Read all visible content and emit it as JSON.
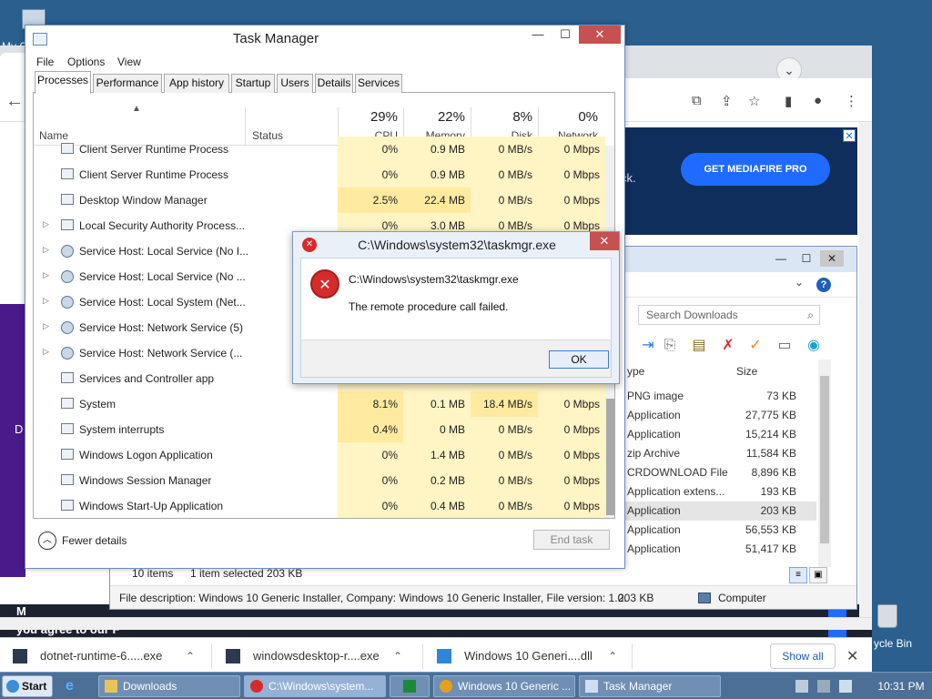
{
  "desktop": {
    "my_computer_label": "My C",
    "recycle_bin_label": "ycle Bin"
  },
  "browser": {
    "ad_text": "ck.",
    "promo_button": "GET MEDIAFIRE PRO",
    "banner_close": "✕",
    "side_letter": "D",
    "agree_text": "you agree to our F",
    "m_text": "M",
    "accent_color": "#1f6bff"
  },
  "downloads": {
    "items": [
      {
        "name": "dotnet-runtime-6.....exe"
      },
      {
        "name": "windowsdesktop-r....exe"
      },
      {
        "name": "Windows 10 Generi....dll"
      }
    ],
    "show_all": "Show all",
    "close": "✕"
  },
  "explorer": {
    "search_placeholder": "Search Downloads",
    "col_type": "ype",
    "col_size": "Size",
    "rows": [
      {
        "type": "PNG image",
        "size": "73 KB"
      },
      {
        "type": "Application",
        "size": "27,775 KB"
      },
      {
        "type": "Application",
        "size": "15,214 KB"
      },
      {
        "type": "zip Archive",
        "size": "11,584 KB"
      },
      {
        "type": "CRDOWNLOAD File",
        "size": "8,896 KB"
      },
      {
        "type": "Application extens...",
        "size": "193 KB"
      },
      {
        "type": "Application",
        "size": "203 KB"
      },
      {
        "type": "Application",
        "size": "56,553 KB"
      },
      {
        "type": "Application",
        "size": "51,417 KB"
      }
    ],
    "status_items": "10 items",
    "status_selected": "1 item selected  203 KB",
    "description": "File description: Windows 10 Generic Installer, Company: Windows 10 Generic Installer, File version: 1.0.",
    "desc_size": "203 KB",
    "computer_label": "Computer"
  },
  "taskmgr": {
    "title": "Task Manager",
    "menu": [
      "File",
      "Options",
      "View"
    ],
    "tabs": [
      "Processes",
      "Performance",
      "App history",
      "Startup",
      "Users",
      "Details",
      "Services"
    ],
    "headers": {
      "name": "Name",
      "status": "Status",
      "cpu_pct": "29%",
      "cpu": "CPU",
      "mem_pct": "22%",
      "mem": "Memory",
      "disk_pct": "8%",
      "disk": "Disk",
      "net_pct": "0%",
      "net": "Network"
    },
    "rows": [
      {
        "name": "Client Server Runtime Process",
        "cpu": "0%",
        "mem": "0.9 MB",
        "disk": "0 MB/s",
        "net": "0 Mbps",
        "expand": false,
        "gear": false
      },
      {
        "name": "Client Server Runtime Process",
        "cpu": "0%",
        "mem": "0.9 MB",
        "disk": "0 MB/s",
        "net": "0 Mbps",
        "expand": false,
        "gear": false
      },
      {
        "name": "Desktop Window Manager",
        "cpu": "2.5%",
        "mem": "22.4 MB",
        "disk": "0 MB/s",
        "net": "0 Mbps",
        "expand": false,
        "gear": false
      },
      {
        "name": "Local Security Authority Process...",
        "cpu": "0%",
        "mem": "3.0 MB",
        "disk": "0 MB/s",
        "net": "0 Mbps",
        "expand": true,
        "gear": false
      },
      {
        "name": "Service Host: Local Service (No I...",
        "cpu": "",
        "mem": "",
        "disk": "",
        "net": "",
        "expand": true,
        "gear": true
      },
      {
        "name": "Service Host: Local Service (No ...",
        "cpu": "",
        "mem": "",
        "disk": "",
        "net": "",
        "expand": true,
        "gear": true
      },
      {
        "name": "Service Host: Local System (Net...",
        "cpu": "",
        "mem": "",
        "disk": "",
        "net": "",
        "expand": true,
        "gear": true
      },
      {
        "name": "Service Host: Network Service (5)",
        "cpu": "",
        "mem": "",
        "disk": "",
        "net": "",
        "expand": true,
        "gear": true
      },
      {
        "name": "Service Host: Network Service (...",
        "cpu": "",
        "mem": "",
        "disk": "",
        "net": "",
        "expand": true,
        "gear": true
      },
      {
        "name": "Services and Controller app",
        "cpu": "",
        "mem": "",
        "disk": "",
        "net": "",
        "expand": false,
        "gear": false
      },
      {
        "name": "System",
        "cpu": "8.1%",
        "mem": "0.1 MB",
        "disk": "18.4 MB/s",
        "net": "0 Mbps",
        "expand": false,
        "gear": false
      },
      {
        "name": "System interrupts",
        "cpu": "0.4%",
        "mem": "0 MB",
        "disk": "0 MB/s",
        "net": "0 Mbps",
        "expand": false,
        "gear": false
      },
      {
        "name": "Windows Logon Application",
        "cpu": "0%",
        "mem": "1.4 MB",
        "disk": "0 MB/s",
        "net": "0 Mbps",
        "expand": false,
        "gear": false
      },
      {
        "name": "Windows Session Manager",
        "cpu": "0%",
        "mem": "0.2 MB",
        "disk": "0 MB/s",
        "net": "0 Mbps",
        "expand": false,
        "gear": false
      },
      {
        "name": "Windows Start-Up Application",
        "cpu": "0%",
        "mem": "0.4 MB",
        "disk": "0 MB/s",
        "net": "0 Mbps",
        "expand": false,
        "gear": false
      }
    ],
    "fewer_details": "Fewer details",
    "end_task": "End task",
    "heat_colors": {
      "light": "#fff4c4",
      "mid": "#ffeaa0"
    }
  },
  "error_dialog": {
    "title": "C:\\Windows\\system32\\taskmgr.exe",
    "line1": "C:\\Windows\\system32\\taskmgr.exe",
    "line2": "The remote procedure call failed.",
    "ok": "OK",
    "close": "✕",
    "error_color": "#d72b2b"
  },
  "taskbar": {
    "start": "Start",
    "items": [
      {
        "label": "Downloads",
        "active": false
      },
      {
        "label": "C:\\Windows\\system...",
        "active": true
      },
      {
        "label": "",
        "active": false
      },
      {
        "label": "Windows 10 Generic ...",
        "active": false
      },
      {
        "label": "Task Manager",
        "active": false
      }
    ],
    "clock": "10:31 PM"
  }
}
